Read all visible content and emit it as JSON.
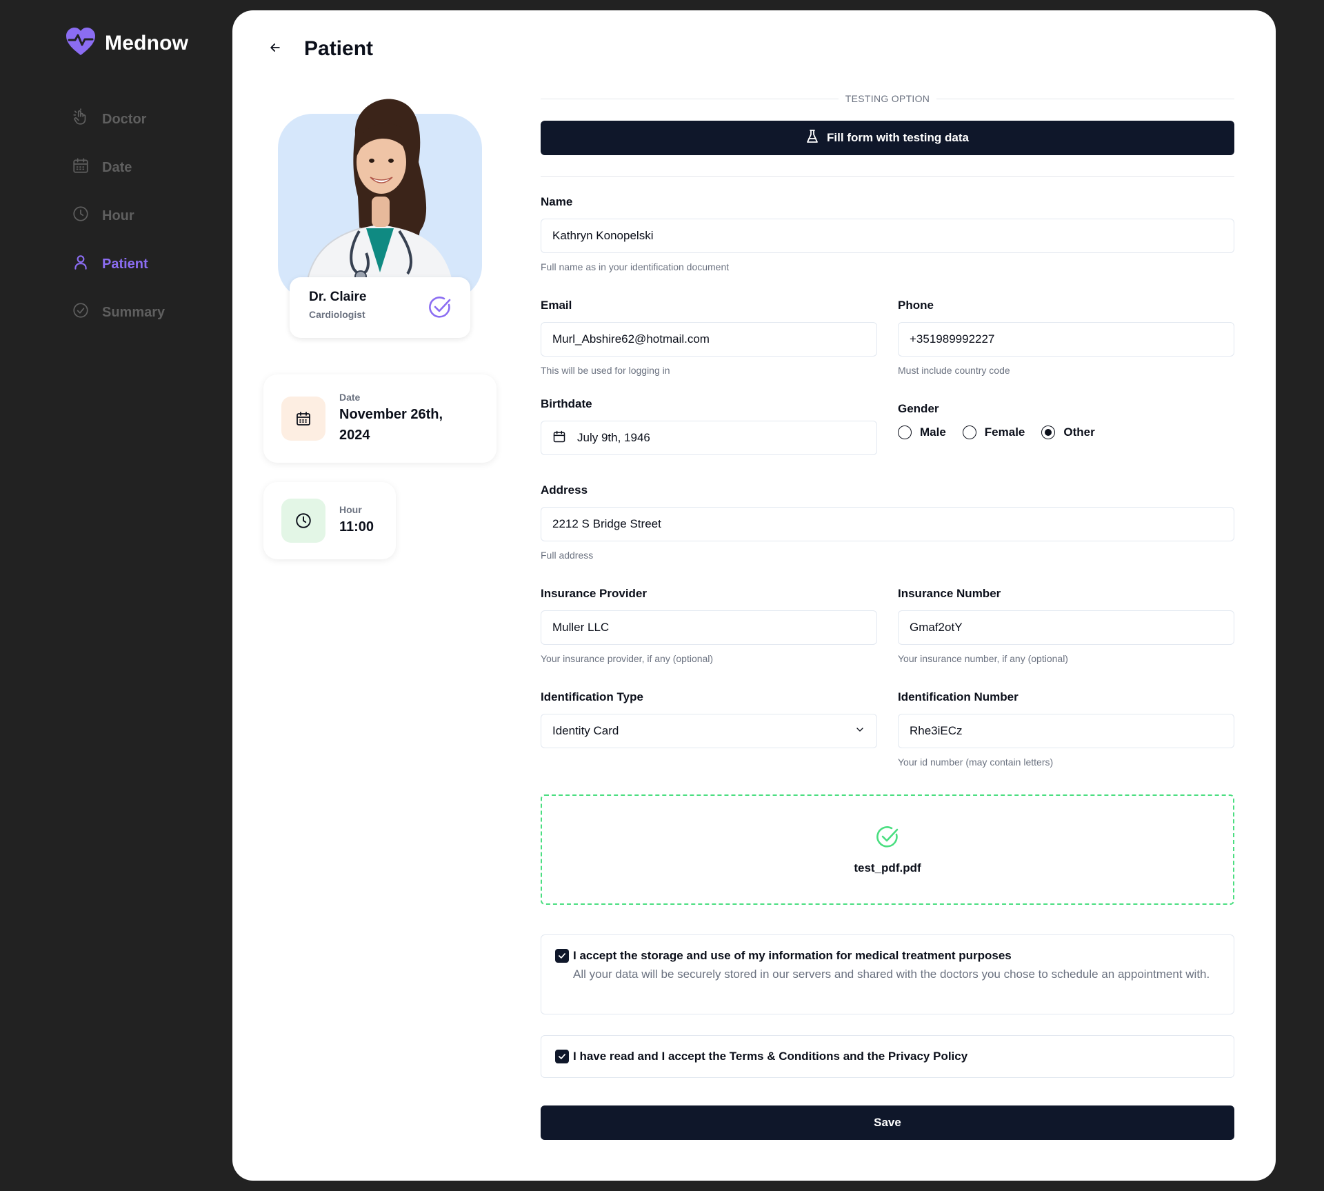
{
  "brand": {
    "name": "Mednow",
    "logo_icon": "heart-pulse-icon"
  },
  "sidebar": {
    "items": [
      {
        "label": "Doctor",
        "icon": "hand-pointer-icon"
      },
      {
        "label": "Date",
        "icon": "calendar-icon"
      },
      {
        "label": "Hour",
        "icon": "clock-icon"
      },
      {
        "label": "Patient",
        "icon": "user-icon",
        "active": true
      },
      {
        "label": "Summary",
        "icon": "check-circle-icon"
      }
    ]
  },
  "header": {
    "title": "Patient"
  },
  "doctor": {
    "name": "Dr. Claire",
    "specialty": "Cardiologist"
  },
  "appointment": {
    "date_label": "Date",
    "date_value_line1": "November 26th,",
    "date_value_line2": "2024",
    "hour_label": "Hour",
    "hour_value": "11:00"
  },
  "form": {
    "testing_option_label": "TESTING OPTION",
    "fill_button_label": "Fill form with testing data",
    "name": {
      "label": "Name",
      "value": "Kathryn Konopelski",
      "hint": "Full name as in your identification document"
    },
    "email": {
      "label": "Email",
      "value": "Murl_Abshire62@hotmail.com",
      "hint": "This will be used for logging in"
    },
    "phone": {
      "label": "Phone",
      "value": "+351989992227",
      "hint": "Must include country code"
    },
    "birthdate": {
      "label": "Birthdate",
      "value": "July 9th, 1946"
    },
    "gender": {
      "label": "Gender",
      "options": [
        "Male",
        "Female",
        "Other"
      ],
      "selected": "Other"
    },
    "address": {
      "label": "Address",
      "value": "2212 S Bridge Street",
      "hint": "Full address"
    },
    "insurance_provider": {
      "label": "Insurance Provider",
      "value": "Muller LLC",
      "hint": "Your insurance provider, if any (optional)"
    },
    "insurance_number": {
      "label": "Insurance Number",
      "value": "Gmaf2otY",
      "hint": "Your insurance number, if any (optional)"
    },
    "identification_type": {
      "label": "Identification Type",
      "value": "Identity Card"
    },
    "identification_number": {
      "label": "Identification Number",
      "value": "Rhe3iECz",
      "hint": "Your id number (may contain letters)"
    },
    "upload": {
      "file_name": "test_pdf.pdf"
    },
    "consent_storage": {
      "title": "I accept the storage and use of my information for medical treatment purposes",
      "description": "All your data will be securely stored in our servers and shared with the doctors you chose to schedule an appointment with.",
      "checked": true
    },
    "consent_terms": {
      "title": "I have read and I accept the Terms & Conditions and the Privacy Policy",
      "checked": true
    },
    "save_label": "Save"
  },
  "colors": {
    "accent": "#8b6df2",
    "primary": "#0f172a",
    "success": "#4ade80",
    "sidebar_bg": "#222222"
  }
}
